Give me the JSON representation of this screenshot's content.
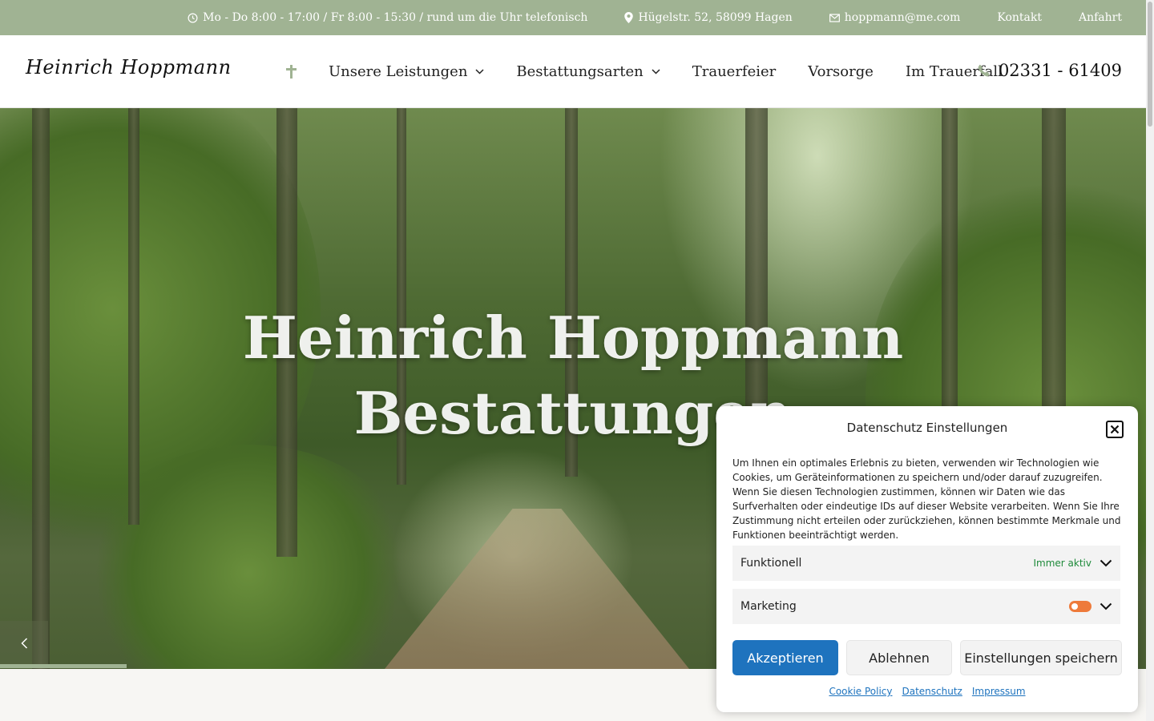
{
  "topbar": {
    "hours": "Mo - Do 8:00 - 17:00 / Fr 8:00 - 15:30 / rund um die Uhr telefonisch",
    "address": "Hügelstr. 52, 58099 Hagen",
    "email": "hoppmann@me.com",
    "kontakt": "Kontakt",
    "anfahrt": "Anfahrt"
  },
  "header": {
    "logo": "Heinrich Hoppmann",
    "nav": [
      {
        "label": "Unsere Leistungen"
      },
      {
        "label": "Bestattungsarten"
      },
      {
        "label": "Trauerfeier"
      },
      {
        "label": "Vorsorge"
      },
      {
        "label": "Im Trauerfall"
      }
    ],
    "phone": "02331 - 61409"
  },
  "hero": {
    "title_line1": "Heinrich Hoppmann",
    "title_line2": "Bestattungen"
  },
  "cookie": {
    "title": "Datenschutz Einstellungen",
    "text": "Um Ihnen ein optimales Erlebnis zu bieten, verwenden wir Technologien wie Cookies, um Geräteinformationen zu speichern und/oder darauf zuzugreifen. Wenn Sie diesen Technologien zustimmen, können wir Daten wie das Surfverhalten oder eindeutige IDs auf dieser Website verarbeiten. Wenn Sie Ihre Zustimmung nicht erteilen oder zurückziehen, können bestimmte Merkmale und Funktionen beeinträchtigt werden.",
    "categories": [
      {
        "label": "Funktionell",
        "status": "Immer aktiv"
      },
      {
        "label": "Marketing"
      }
    ],
    "accept": "Akzeptieren",
    "deny": "Ablehnen",
    "save": "Einstellungen speichern",
    "links": [
      "Cookie Policy",
      "Datenschutz",
      "Impressum"
    ]
  },
  "colors": {
    "accent_green": "#a0b393",
    "button_blue": "#1e73be",
    "toggle_orange": "#ee7a3a",
    "always_active_green": "#1e8a3a"
  }
}
